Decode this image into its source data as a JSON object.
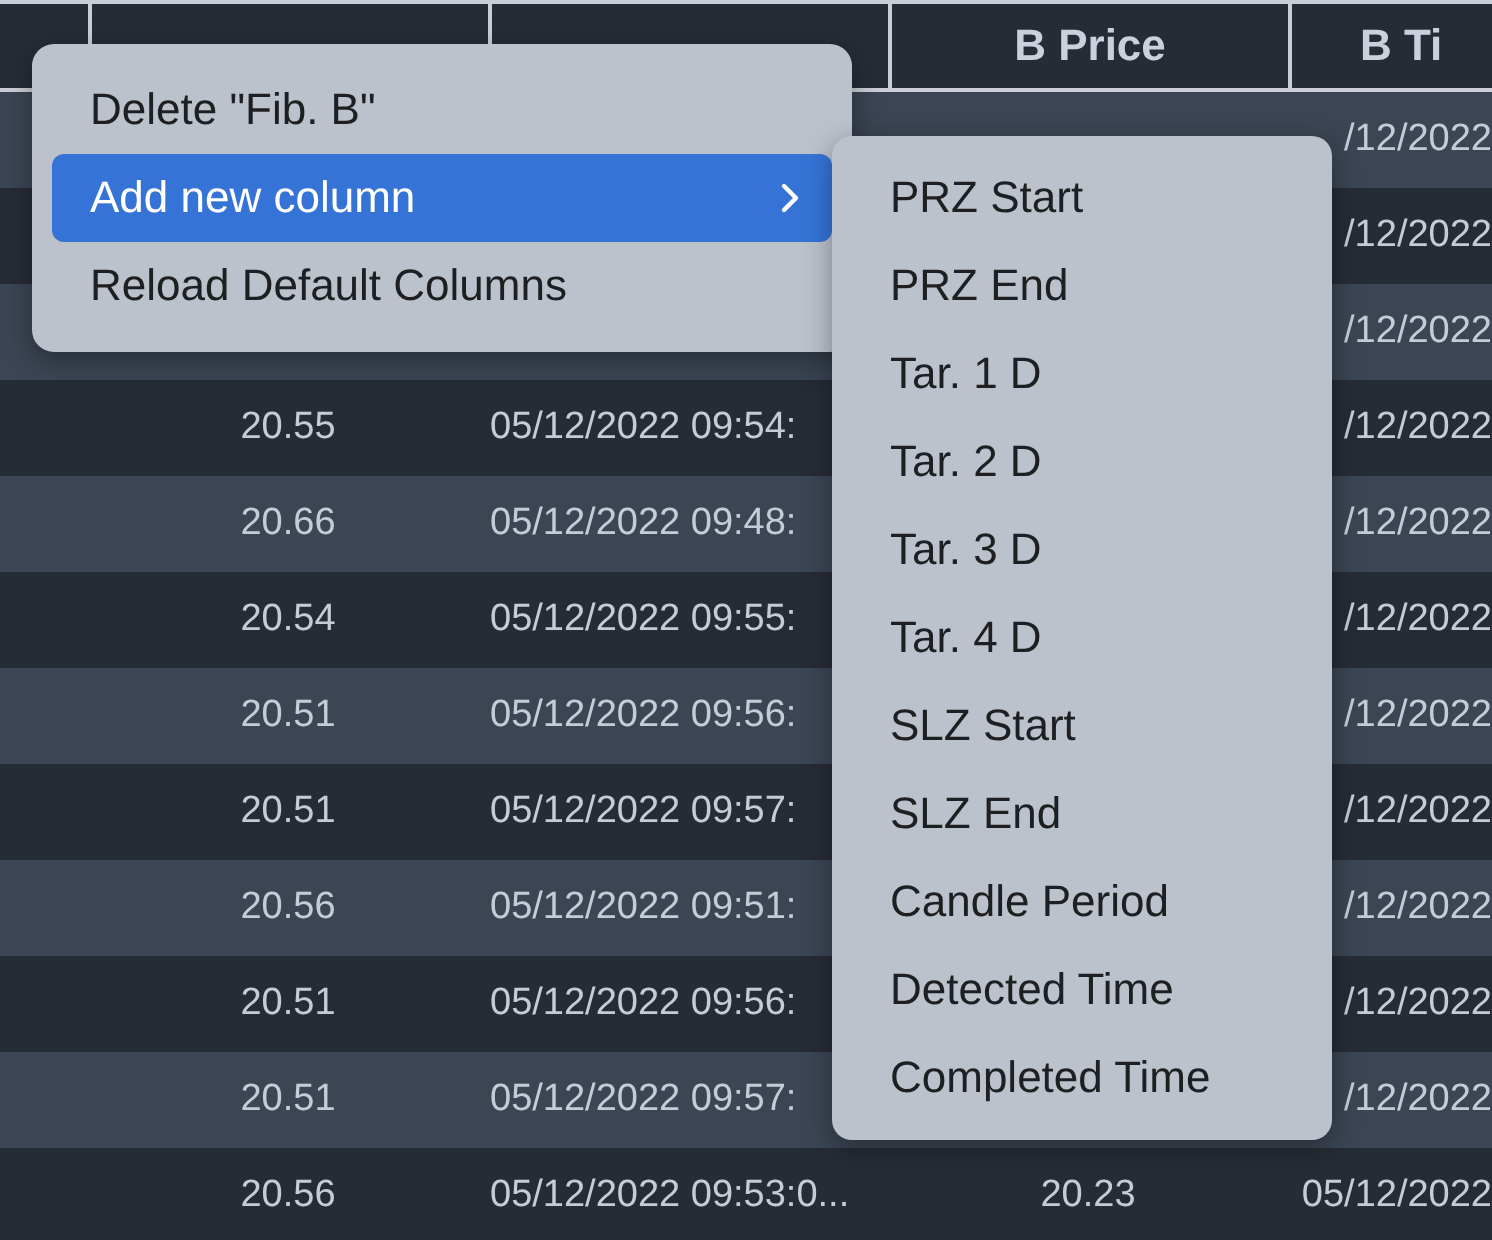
{
  "table": {
    "columns": [
      "B Price",
      "B Ti"
    ],
    "rows": [
      {
        "b_time": "/12/2022"
      },
      {
        "b_time": "/12/2022"
      },
      {
        "b_time": "/12/2022"
      },
      {
        "a_price": "20.55",
        "a_time": "05/12/2022 09:54:",
        "b_time": "/12/2022"
      },
      {
        "a_price": "20.66",
        "a_time": "05/12/2022 09:48:",
        "b_time": "/12/2022"
      },
      {
        "a_price": "20.54",
        "a_time": "05/12/2022 09:55:",
        "b_time": "/12/2022"
      },
      {
        "a_price": "20.51",
        "a_time": "05/12/2022 09:56:",
        "b_time": "/12/2022"
      },
      {
        "a_price": "20.51",
        "a_time": "05/12/2022 09:57:",
        "b_time": "/12/2022"
      },
      {
        "a_price": "20.56",
        "a_time": "05/12/2022 09:51:",
        "b_time": "/12/2022"
      },
      {
        "a_price": "20.51",
        "a_time": "05/12/2022 09:56:",
        "b_time": "/12/2022"
      },
      {
        "a_price": "20.51",
        "a_time": "05/12/2022 09:57:",
        "b_time": "/12/2022"
      },
      {
        "a_price": "20.56",
        "a_time": "05/12/2022 09:53:0...",
        "b_price": "20.23",
        "b_time": "05/12/2022"
      }
    ]
  },
  "context_menu": {
    "items": [
      {
        "label": "Delete \"Fib. B\"",
        "selected": false,
        "has_submenu": false
      },
      {
        "label": "Add new column",
        "selected": true,
        "has_submenu": true
      },
      {
        "label": "Reload Default Columns",
        "selected": false,
        "has_submenu": false
      }
    ]
  },
  "submenu": {
    "items": [
      "PRZ Start",
      "PRZ End",
      "Tar. 1 D",
      "Tar. 2 D",
      "Tar. 3 D",
      "Tar. 4 D",
      "SLZ Start",
      "SLZ End",
      "Candle Period",
      "Detected Time",
      "Completed Time"
    ]
  }
}
